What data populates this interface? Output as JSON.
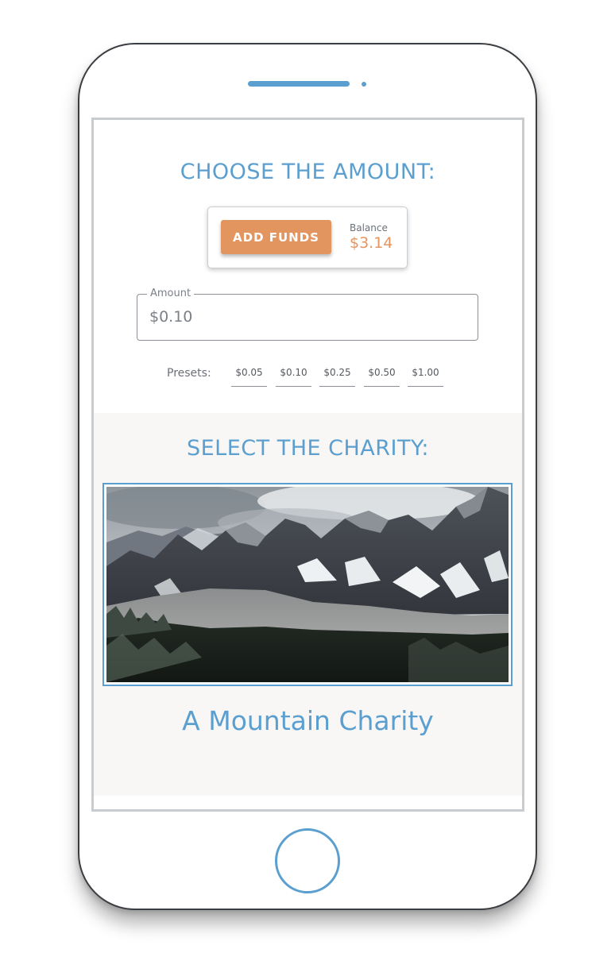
{
  "amount_section": {
    "title": "CHOOSE THE AMOUNT:",
    "add_funds_label": "ADD FUNDS",
    "balance_label": "Balance",
    "balance_value": "$3.14",
    "amount_field_label": "Amount",
    "amount_value": "$0.10",
    "presets_label": "Presets:",
    "presets": [
      "$0.05",
      "$0.10",
      "$0.25",
      "$0.50",
      "$1.00"
    ]
  },
  "charity_section": {
    "title": "SELECT THE CHARITY:",
    "charity_name": "A Mountain Charity",
    "image_subject": "mountain-landscape"
  },
  "colors": {
    "accent_blue": "#5a9fcf",
    "accent_orange": "#e3955f",
    "section_background": "#f8f7f5"
  }
}
